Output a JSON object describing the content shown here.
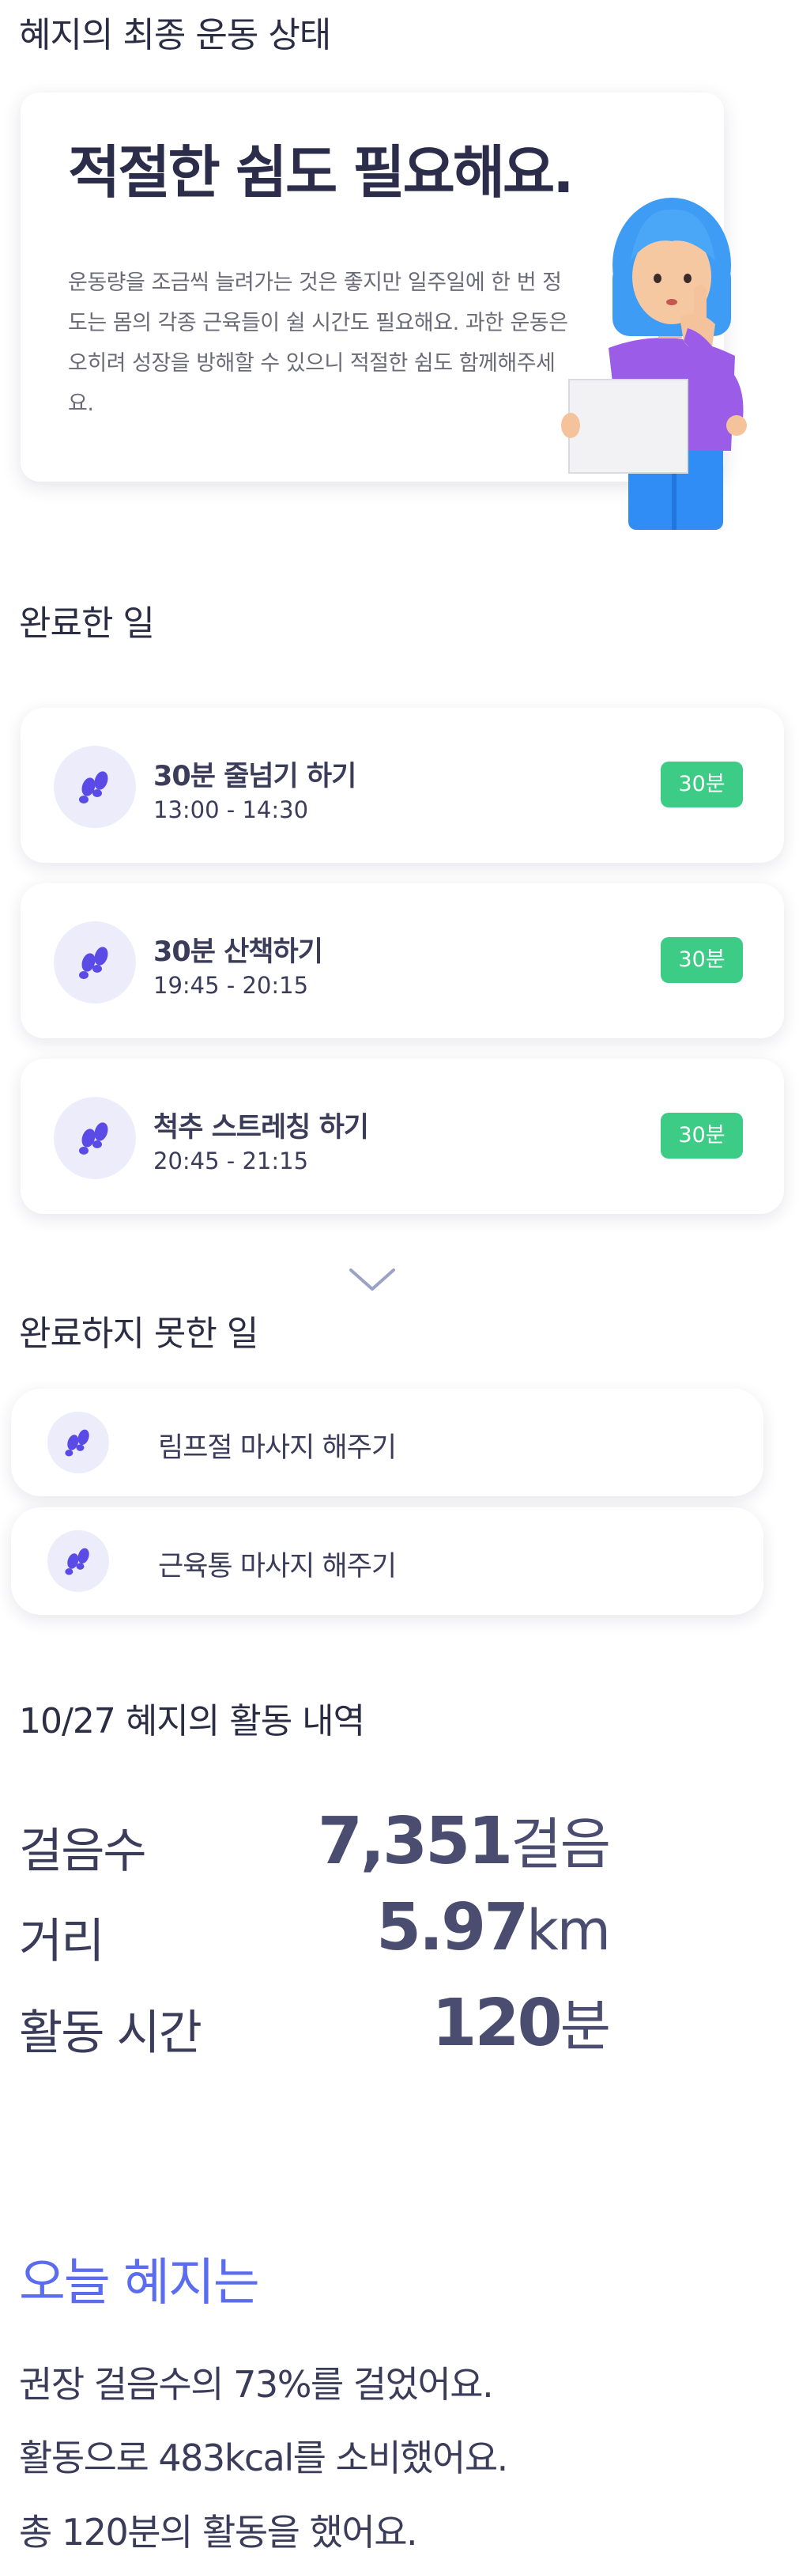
{
  "status_section": {
    "title": "혜지의 최종 운동 상태",
    "headline": "적절한 쉼도 필요해요.",
    "description": "운동량을 조금씩 늘려가는 것은 좋지만 일주일에 한 번 정도는 몸의 각종 근육들이 쉴 시간도 필요해요. 과한 운동은 오히려 성장을 방해할 수 있으니 적절한 쉼도 함께해주세요."
  },
  "completed": {
    "title": "완료한 일",
    "items": [
      {
        "title": "30분 줄넘기 하기",
        "time": "13:00 - 14:30",
        "duration": "30분"
      },
      {
        "title": "30분 산책하기",
        "time": "19:45 - 20:15",
        "duration": "30분"
      },
      {
        "title": "척추 스트레칭 하기",
        "time": "20:45 - 21:15",
        "duration": "30분"
      }
    ]
  },
  "incomplete": {
    "title": "완료하지 못한 일",
    "items": [
      {
        "label": "림프절 마사지 해주기"
      },
      {
        "label": "근육통 마사지 해주기"
      }
    ]
  },
  "activity": {
    "title": "10/27 혜지의 활동 내역",
    "stats": [
      {
        "label": "걸음수",
        "value": "7,351",
        "unit": "걸음"
      },
      {
        "label": "거리",
        "value": "5.97",
        "unit": "km"
      },
      {
        "label": "활동 시간",
        "value": "120",
        "unit": "분"
      }
    ]
  },
  "today": {
    "title": "오늘 혜지는",
    "lines": [
      "권장 걸음수의 73%를 걸었어요.",
      "활동으로 483kcal를 소비했어요.",
      "총 120분의 활동을 했어요."
    ]
  },
  "colors": {
    "accent": "#5b6cf0",
    "badge": "#3dcc85",
    "icon_bg": "#ececfb",
    "icon_fg": "#5b4be6"
  },
  "icons": {
    "task": "footsteps-icon",
    "expand": "chevron-down-icon"
  }
}
